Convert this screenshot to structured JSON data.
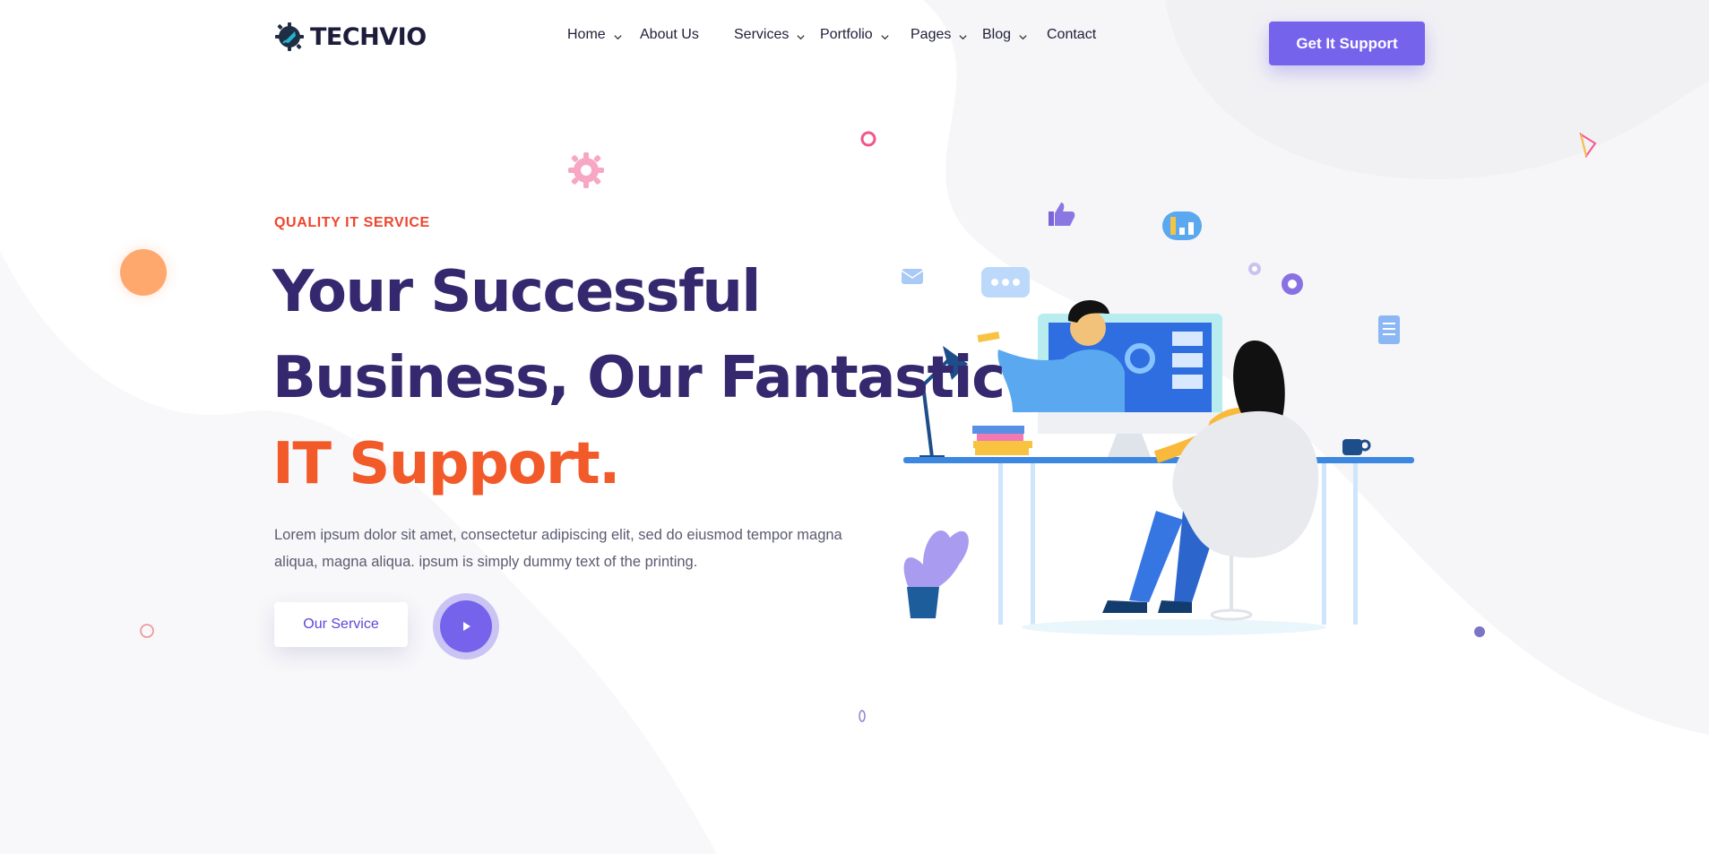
{
  "brand": {
    "name": "TECHVIO",
    "logo_icon": "gear-rocket-icon"
  },
  "nav": {
    "items": [
      {
        "label": "Home",
        "has_dropdown": true
      },
      {
        "label": "About Us",
        "has_dropdown": false
      },
      {
        "label": "Services",
        "has_dropdown": true
      },
      {
        "label": "Portfolio",
        "has_dropdown": true
      },
      {
        "label": "Pages",
        "has_dropdown": true
      },
      {
        "label": "Blog",
        "has_dropdown": true
      },
      {
        "label": "Contact",
        "has_dropdown": false
      }
    ],
    "cta_label": "Get It Support"
  },
  "hero": {
    "eyebrow": "QUALITY IT SERVICE",
    "title_line1": "Your Successful",
    "title_line2": "Business, Our Fantastic",
    "title_line3": "IT Support.",
    "description": "Lorem ipsum dolor sit amet, consectetur adipiscing elit, sed do eiusmod tempor magna aliqua, magna aliqua. ipsum is simply dummy text of the printing.",
    "service_button": "Our Service",
    "play_icon": "play-icon"
  },
  "colors": {
    "primary": "#7563ec",
    "heading": "#35286e",
    "accent": "#f25a2a",
    "eyebrow": "#f0452c",
    "body_text": "#5b5b72"
  }
}
